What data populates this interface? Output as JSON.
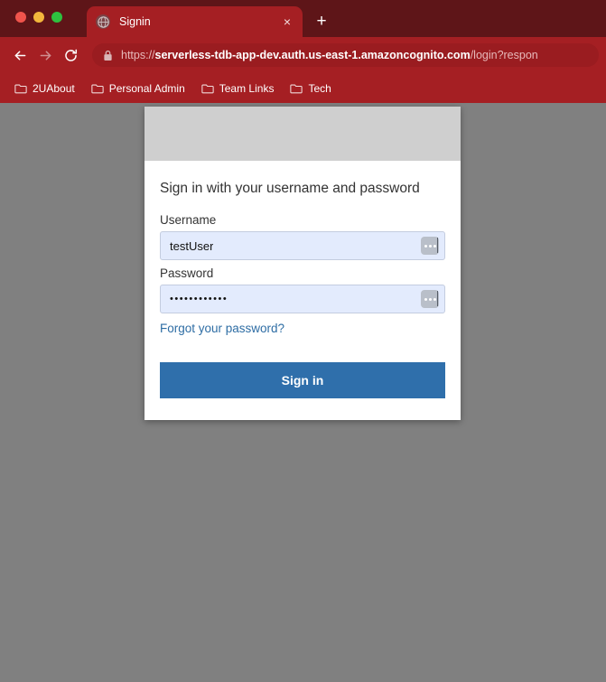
{
  "browser": {
    "window_controls": [
      "close",
      "minimize",
      "maximize"
    ],
    "tab": {
      "title": "Signin",
      "favicon": "globe-icon",
      "close_label": "×"
    },
    "new_tab_label": "+",
    "nav": {
      "back": "back-arrow",
      "forward": "forward-arrow",
      "reload": "reload-icon"
    },
    "omnibox": {
      "lock": "lock-icon",
      "scheme": "https://",
      "host": "serverless-tdb-app-dev.auth.us-east-1.amazoncognito.com",
      "path": "/login?respon",
      "full_url": "https://serverless-tdb-app-dev.auth.us-east-1.amazoncognito.com/login?respon"
    },
    "bookmarks": [
      {
        "label": "2UAbout",
        "icon": "folder-icon"
      },
      {
        "label": "Personal Admin",
        "icon": "folder-icon"
      },
      {
        "label": "Team Links",
        "icon": "folder-icon"
      },
      {
        "label": "Tech",
        "icon": "folder-icon"
      }
    ]
  },
  "page": {
    "background_color": "#808080",
    "card": {
      "banner_color": "#cfcfcf",
      "title": "Sign in with your username and password",
      "username": {
        "label": "Username",
        "value": "testUser",
        "placeholder": "Username",
        "autofill_icon": "autofill-dots-icon"
      },
      "password": {
        "label": "Password",
        "value": "••••••••••••",
        "placeholder": "Password",
        "autofill_icon": "autofill-dots-icon"
      },
      "forgot_link": "Forgot your password?",
      "submit_label": "Sign in",
      "accent_color": "#2f6fab",
      "link_color": "#2e6da4"
    }
  },
  "theme": {
    "tabstrip": "#5e1518",
    "toolbar": "#a51f23",
    "omnibox": "#9a1c20",
    "input_autofill": "#e3ebfd"
  }
}
